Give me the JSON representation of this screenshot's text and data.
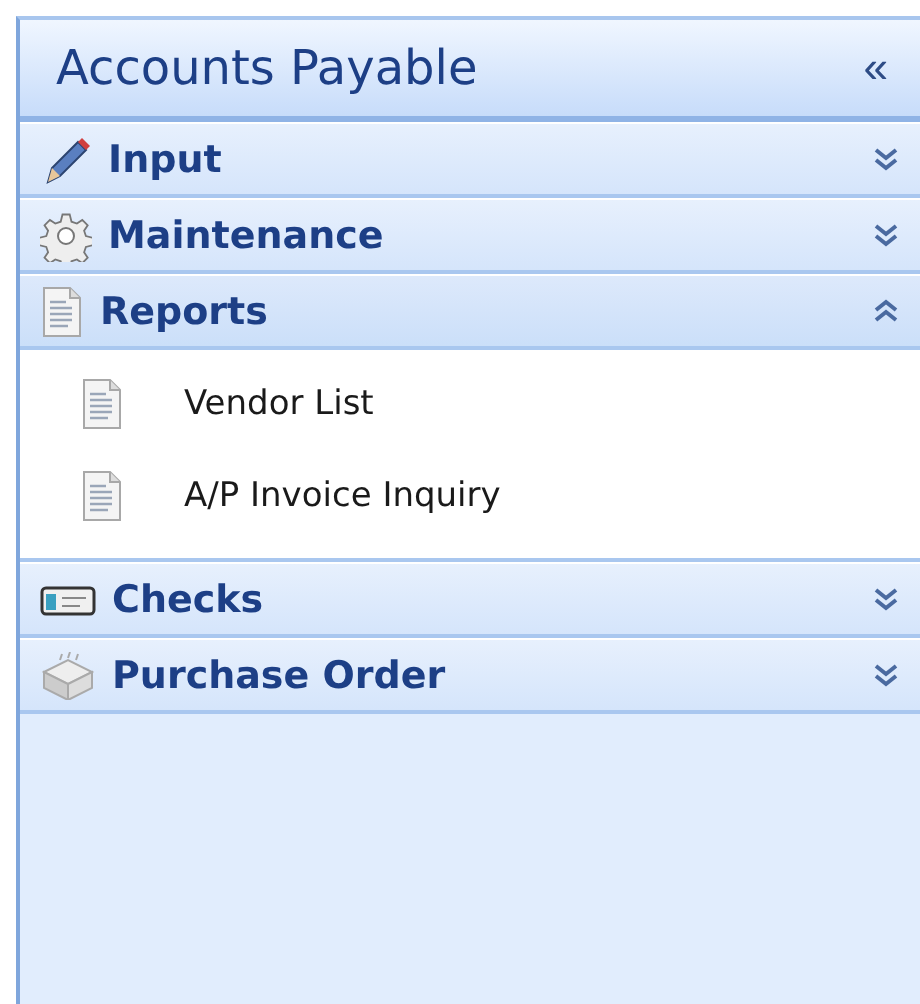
{
  "panel": {
    "title": "Accounts Payable",
    "collapse_glyph": "«"
  },
  "groups": [
    {
      "label": "Input",
      "expanded": false
    },
    {
      "label": "Maintenance",
      "expanded": false
    },
    {
      "label": "Reports",
      "expanded": true,
      "items": [
        {
          "label": "Vendor List"
        },
        {
          "label": "A/P Invoice Inquiry"
        }
      ]
    },
    {
      "label": "Checks",
      "expanded": false
    },
    {
      "label": "Purchase Order",
      "expanded": false
    }
  ]
}
